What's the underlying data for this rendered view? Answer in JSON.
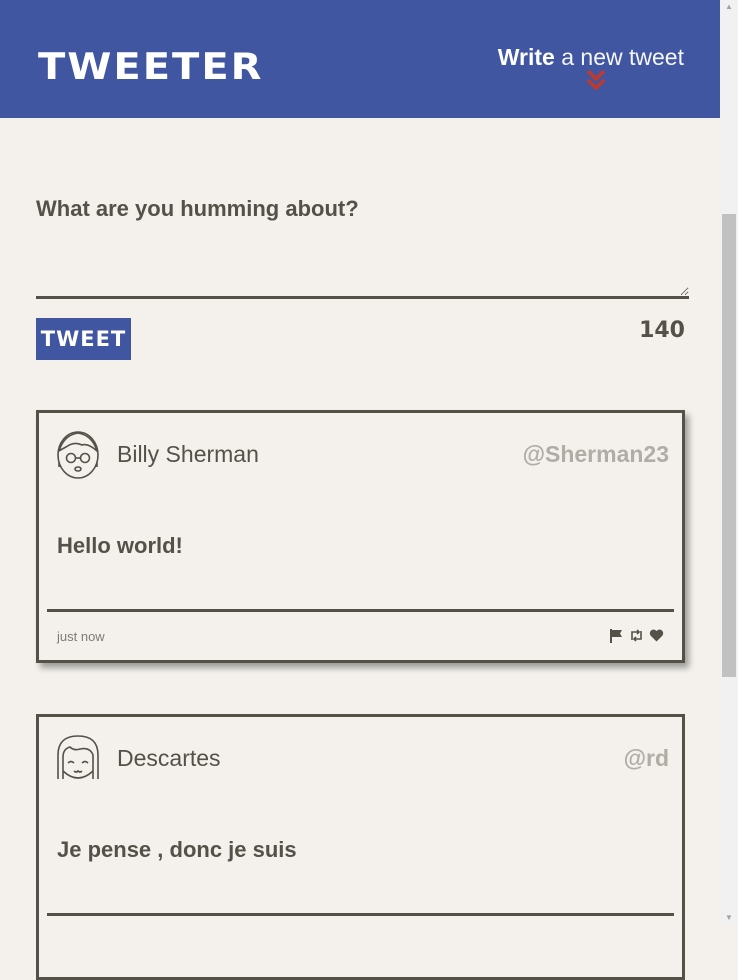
{
  "nav": {
    "logo": "TWEETER",
    "compose_bold": "Write",
    "compose_rest": " a new tweet",
    "chevron_icon": "double-chevron-down-icon",
    "chevron_color": "#c0392b",
    "bg_color": "#4056a1"
  },
  "new_tweet": {
    "prompt": "What are you humming about?",
    "text_value": "",
    "submit_label": "TWEET",
    "counter": "140"
  },
  "tweets": [
    {
      "name": "Billy Sherman",
      "handle": "@Sherman23",
      "content": "Hello world!",
      "time": "just now",
      "avatar_icon": "glasses-boy-avatar-icon"
    },
    {
      "name": "Descartes",
      "handle": "@rd",
      "content": "Je pense , donc je suis",
      "time": "",
      "avatar_icon": "bob-hair-avatar-icon"
    }
  ],
  "actions": {
    "flag_icon": "flag-icon",
    "retweet_icon": "retweet-icon",
    "like_icon": "heart-icon"
  }
}
